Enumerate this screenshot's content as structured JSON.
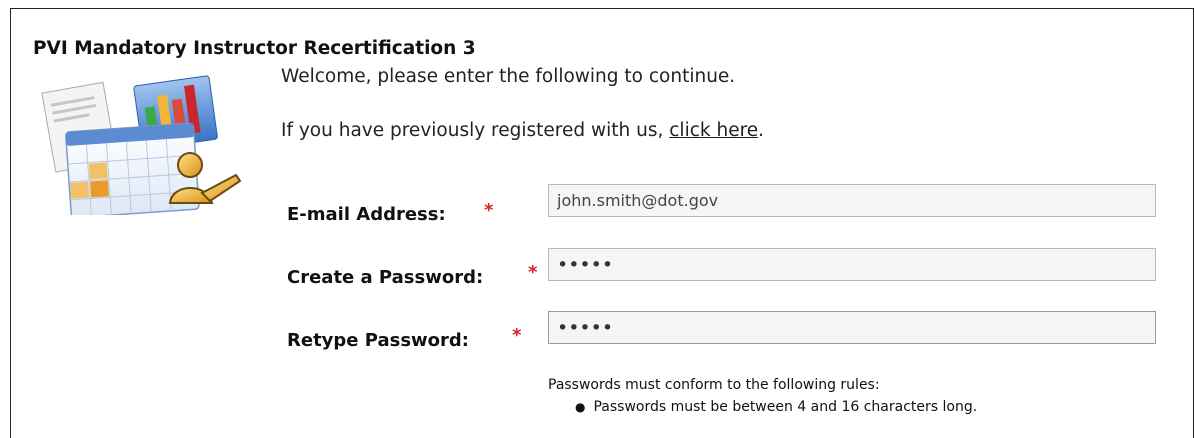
{
  "page": {
    "title": "PVI Mandatory Instructor Recertification 3",
    "welcome": "Welcome, please enter the following to continue.",
    "previously_prefix": "If you have previously registered with us, ",
    "click_here": "click here",
    "previously_suffix": "."
  },
  "form": {
    "email": {
      "label": "E-mail Address:",
      "value": "john.smith@dot.gov"
    },
    "password": {
      "label": "Create a Password:",
      "value": "•••••"
    },
    "retype": {
      "label": "Retype Password:",
      "value": "•••••"
    },
    "required_marker": "*"
  },
  "rules": {
    "title": "Passwords must conform to the following rules:",
    "items": [
      "Passwords must be between 4 and 16 characters long."
    ]
  },
  "colors": {
    "required": "#d12424",
    "field_bg": "#f5f5f5",
    "border": "#b8b8b8"
  },
  "icons": {
    "logo": "calendar-presentation-icon"
  }
}
